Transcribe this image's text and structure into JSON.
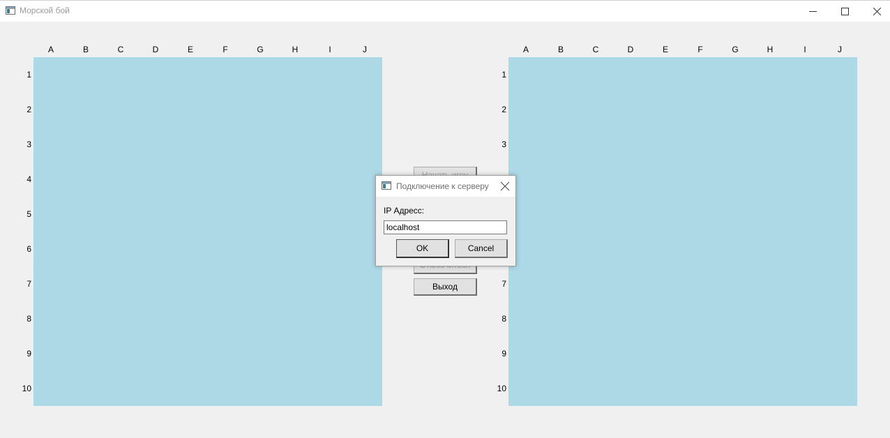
{
  "window": {
    "title": "Морской бой",
    "icon": "app-window-icon",
    "controls": [
      "minimize-icon",
      "maximize-icon",
      "close-icon"
    ]
  },
  "board": {
    "columns": [
      "A",
      "B",
      "C",
      "D",
      "E",
      "F",
      "G",
      "H",
      "I",
      "J"
    ],
    "rows": [
      "1",
      "2",
      "3",
      "4",
      "5",
      "6",
      "7",
      "8",
      "9",
      "10"
    ],
    "water_color": "#add8e6"
  },
  "side_buttons": {
    "start_label": "Начать игру",
    "disconnect_label": "Отключиться",
    "exit_label": "Выход"
  },
  "dialog": {
    "title": "Подключение к серверу",
    "ip_label": "IP Адресс:",
    "ip_value": "localhost",
    "ok_label": "OK",
    "cancel_label": "Cancel"
  }
}
